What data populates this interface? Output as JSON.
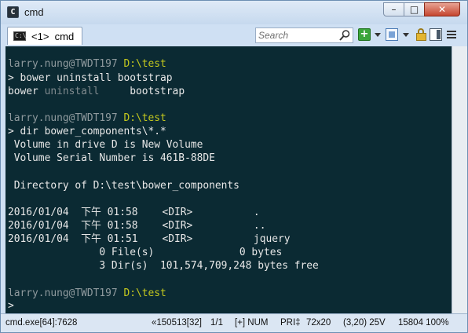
{
  "window": {
    "title": "cmd",
    "app_icon_glyph": "C",
    "controls": {
      "minimize": "–",
      "maximize": "□",
      "close": "✕"
    }
  },
  "toolbar": {
    "tab_label": "<1>  cmd",
    "tab_icon_text": "C:\\",
    "search_placeholder": "Search",
    "new_console_symbol": "+",
    "icons": [
      "search-icon",
      "new-console-icon",
      "split-icon",
      "lock-icon",
      "view-icon",
      "menu-icon"
    ]
  },
  "console": {
    "colors": {
      "background": "#0b2a33",
      "text": "#e8e8e8",
      "prompt_host": "#8f9a9e",
      "prompt_path": "#c4c81e"
    },
    "lines": [
      {
        "host": "larry.nung@TWDT197",
        "path": " D:\\test"
      },
      {
        "text": "> bower uninstall bootstrap"
      },
      {
        "a": "bower",
        "b": " uninstall",
        "c": "     bootstrap"
      },
      {
        "text": ""
      },
      {
        "host": "larry.nung@TWDT197",
        "path": " D:\\test"
      },
      {
        "text": "> dir bower_components\\*.*"
      },
      {
        "text": " Volume in drive D is New Volume"
      },
      {
        "text": " Volume Serial Number is 461B-88DE"
      },
      {
        "text": ""
      },
      {
        "text": " Directory of D:\\test\\bower_components"
      },
      {
        "text": ""
      },
      {
        "text": "2016/01/04  下午 01:58    <DIR>          ."
      },
      {
        "text": "2016/01/04  下午 01:58    <DIR>          .."
      },
      {
        "text": "2016/01/04  下午 01:51    <DIR>          jquery"
      },
      {
        "text": "               0 File(s)              0 bytes"
      },
      {
        "text": "               3 Dir(s)  101,574,709,248 bytes free"
      },
      {
        "text": ""
      },
      {
        "host": "larry.nung@TWDT197",
        "path": " D:\\test"
      },
      {
        "text": ">"
      }
    ]
  },
  "statusbar": {
    "process": "cmd.exe[64]:7628",
    "items": [
      "«150513[32]",
      "1/1",
      "[+] NUM",
      "PRI‡",
      "72x20",
      "(3,20) 25V",
      "15804 100%"
    ]
  }
}
